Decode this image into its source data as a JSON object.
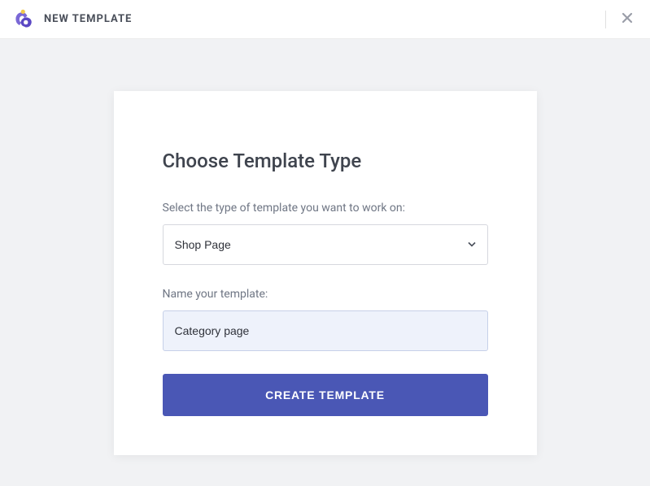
{
  "header": {
    "title": "NEW TEMPLATE"
  },
  "modal": {
    "heading": "Choose Template Type",
    "type_label": "Select the type of template you want to work on:",
    "type_value": "Shop Page",
    "name_label": "Name your template:",
    "name_value": "Category page",
    "submit_label": "CREATE TEMPLATE"
  }
}
